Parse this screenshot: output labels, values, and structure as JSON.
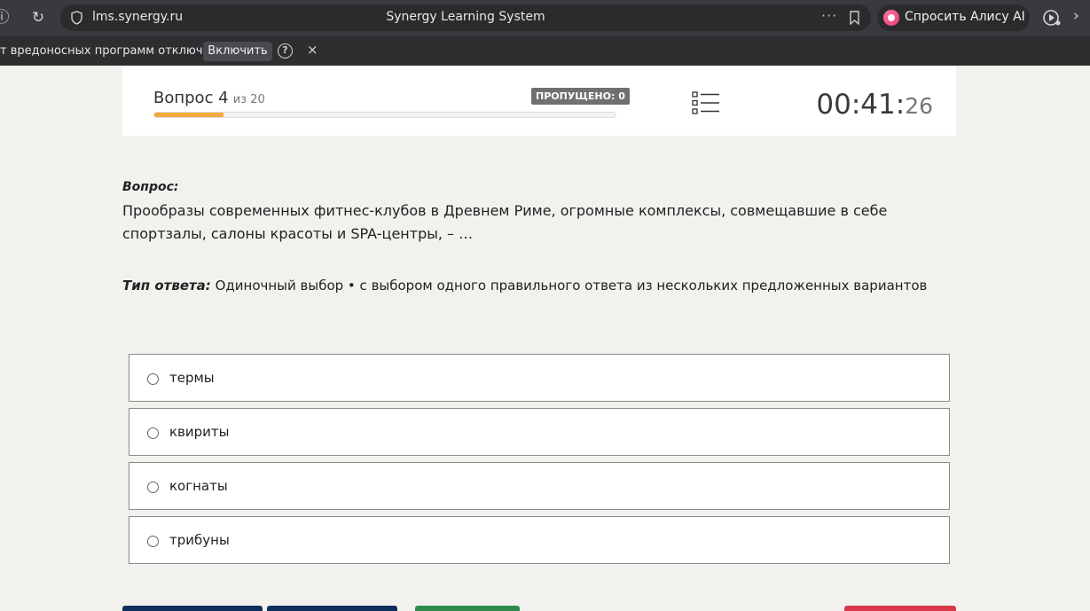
{
  "browser": {
    "url": "lms.synergy.ru",
    "page_title": "Synergy Learning System",
    "alice_label": "Спросить Алису AI"
  },
  "notification": {
    "text": "т вредоносных программ отключена",
    "enable_label": "Включить",
    "help": "?",
    "close": "×"
  },
  "quiz": {
    "question_word": "Вопрос 4",
    "question_of": "из 20",
    "skipped_badge": "ПРОПУЩЕНО: 0",
    "progress_fraction": 0.15,
    "timer_main": "00:41:",
    "timer_seconds": "26"
  },
  "question": {
    "label": "Вопрос:",
    "text": "Прообразы современных фитнес-клубов в Древнем Риме, огромные комплексы, совмещавшие в себе спортзалы, салоны красоты и SPA-центры, – …",
    "type_label": "Тип ответа:",
    "type_value": "Одиночный выбор • с выбором одного правильного ответа из нескольких предложенных вариантов"
  },
  "answers": [
    {
      "label": "термы"
    },
    {
      "label": "квириты"
    },
    {
      "label": "когнаты"
    },
    {
      "label": "трибуны"
    }
  ],
  "colors": {
    "progress": "#f2a93b",
    "btn_navy": "#0f2f5c",
    "btn_green": "#2e8b4c",
    "btn_red": "#d8384a"
  }
}
